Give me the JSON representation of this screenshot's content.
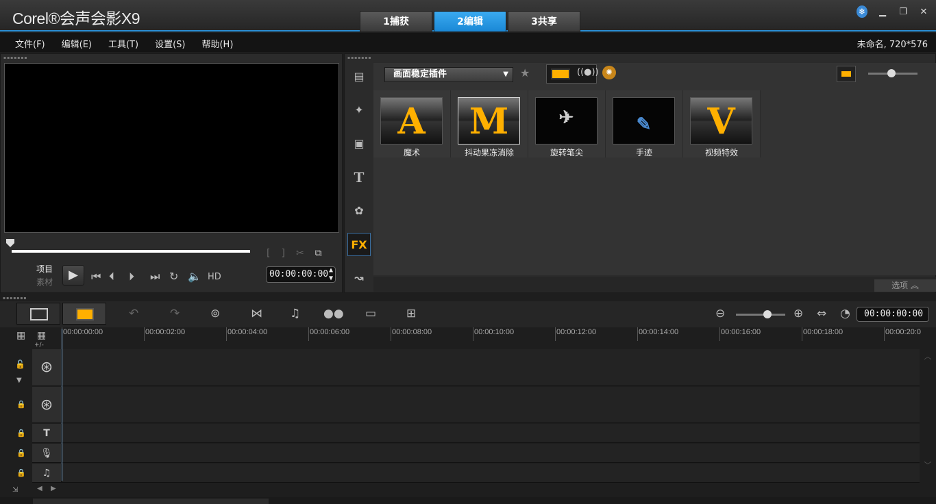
{
  "app": {
    "title": "Corel®会声会影X9"
  },
  "mode_tabs": [
    {
      "label": "1捕获",
      "active": false
    },
    {
      "label": "2编辑",
      "active": true
    },
    {
      "label": "3共享",
      "active": false
    }
  ],
  "menu": {
    "items": [
      "文件(F)",
      "编辑(E)",
      "工具(T)",
      "设置(S)",
      "帮助(H)"
    ],
    "project_info": "未命名, 720*576"
  },
  "preview": {
    "mode_project": "项目",
    "mode_clip": "素材",
    "hd_label": "HD",
    "timecode": "00:00:00:00"
  },
  "library": {
    "filter_dropdown": "画面稳定插件",
    "side_tabs": [
      "media-tab",
      "instant-project-tab",
      "transition-tab",
      "title-tab",
      "graphics-tab",
      "filter-tab",
      "path-tab"
    ],
    "side_tab_fx_label": "FX",
    "thumbnails": [
      {
        "label": "魔术",
        "glyph": "A"
      },
      {
        "label": "抖动果冻消除",
        "glyph": "M"
      },
      {
        "label": "旋转笔尖",
        "glyph": "✈"
      },
      {
        "label": "手迹",
        "glyph": "✎"
      },
      {
        "label": "视频特效",
        "glyph": "V"
      }
    ],
    "options_label": "选项"
  },
  "timeline": {
    "timecode": "00:00:00:00",
    "add_remove_label": "+/-",
    "ruler_ticks": [
      "00:00:00:00",
      "00:00:02:00",
      "00:00:04:00",
      "00:00:06:00",
      "00:00:08:00",
      "00:00:10:00",
      "00:00:12:00",
      "00:00:14:00",
      "00:00:16:00",
      "00:00:18:00",
      "00:00:20:0"
    ],
    "tracks": [
      "video-track",
      "overlay-track",
      "title-track",
      "voice-track",
      "music-track"
    ]
  },
  "colors": {
    "accent": "#2a8fd6",
    "highlight": "#ffb000"
  }
}
